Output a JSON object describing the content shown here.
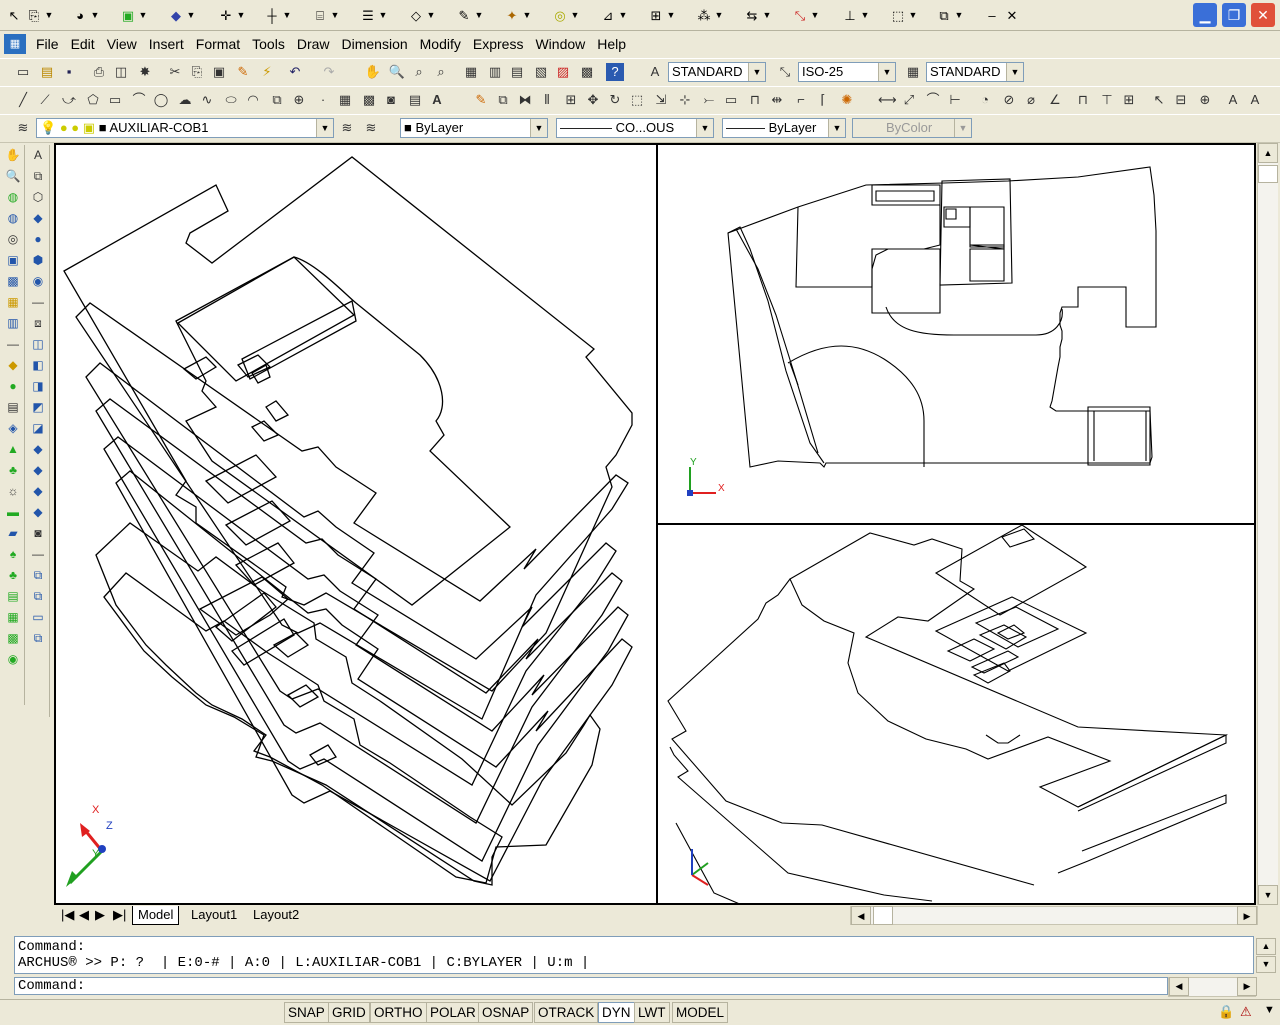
{
  "menu": [
    "File",
    "Edit",
    "View",
    "Insert",
    "Format",
    "Tools",
    "Draw",
    "Dimension",
    "Modify",
    "Express",
    "Window",
    "Help"
  ],
  "styles": {
    "text_style": "STANDARD",
    "dim_style": "ISO-25",
    "table_style": "STANDARD"
  },
  "layer": {
    "current": "AUXILIAR-COB1",
    "color": "ByLayer",
    "linetype": "CO...OUS",
    "lineweight": "ByLayer",
    "plotstyle": "ByColor"
  },
  "tabs": [
    "Model",
    "Layout1",
    "Layout2"
  ],
  "command": {
    "line1": "Command:",
    "line2": "ARCHUS® >> P: ?  | E:0-# | A:0 | L:AUXILIAR-COB1 | C:BYLAYER | U:m |",
    "prompt": "Command:"
  },
  "status_buttons": [
    "SNAP",
    "GRID",
    "ORTHO",
    "POLAR",
    "OSNAP",
    "OTRACK",
    "DYN",
    "LWT",
    "MODEL"
  ],
  "ucs_labels": {
    "x": "X",
    "y": "Y",
    "z": "Z"
  },
  "colors": {
    "ucs_x": "#e02020",
    "ucs_y": "#20a020",
    "ucs_z": "#2040c0",
    "title_close": "#e0503a"
  }
}
